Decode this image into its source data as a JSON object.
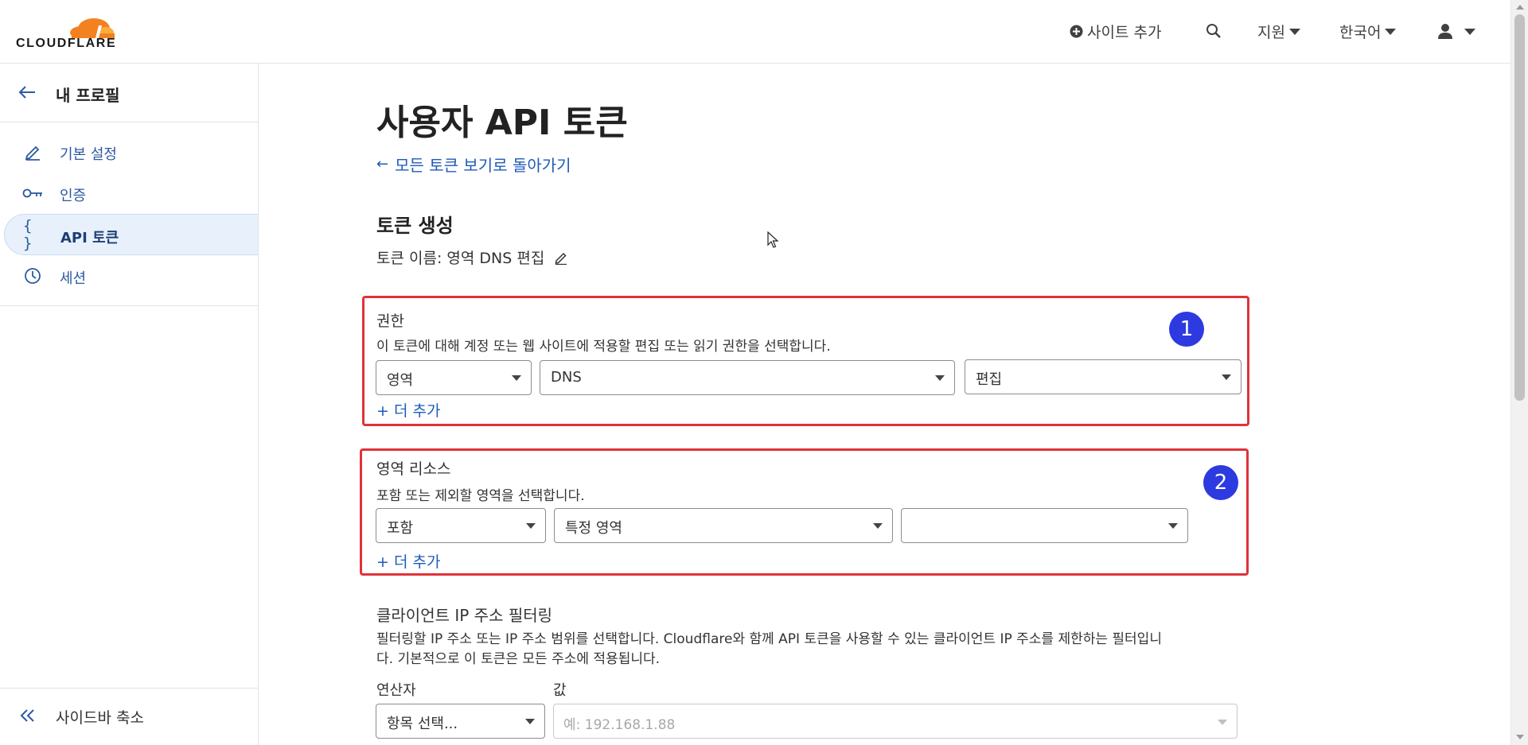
{
  "header": {
    "brand": "CLOUDFLARE",
    "add_site_label": "사이트 추가",
    "support_label": "지원",
    "language_label": "한국어",
    "icons": {
      "add": "plus-circle-icon",
      "search": "search-icon",
      "user": "user-icon"
    },
    "brand_color": "#f48120"
  },
  "sidebar": {
    "back_label": "내 프로필",
    "items": [
      {
        "label": "기본 설정",
        "icon": "pencil-icon",
        "active": false
      },
      {
        "label": "인증",
        "icon": "key-icon",
        "active": false
      },
      {
        "label": "API 토큰",
        "icon": "braces-icon",
        "active": true
      },
      {
        "label": "세션",
        "icon": "clock-icon",
        "active": false
      }
    ],
    "collapse_label": "사이드바 축소"
  },
  "main": {
    "title": "사용자 API 토큰",
    "back_link": "모든 토큰 보기로 돌아가기",
    "section_title": "토큰 생성",
    "token_name": "토큰 이름: 영역 DNS 편집",
    "permissions": {
      "badge": "1",
      "title": "권한",
      "description": "이 토큰에 대해 계정 또는 웹 사이트에 적용할 편집 또는 읽기 권한을 선택합니다.",
      "selects": [
        "영역",
        "DNS",
        "편집"
      ],
      "add_more": "+ 더 추가"
    },
    "zone_resources": {
      "badge": "2",
      "title": "영역 리소스",
      "description": "포함 또는 제외할 영역을 선택합니다.",
      "selects": [
        "포함",
        "특정 영역",
        ""
      ],
      "add_more": "+ 더 추가"
    },
    "ip_filtering": {
      "title": "클라이언트 IP 주소 필터링",
      "description_line1": "필터링할 IP 주소 또는 IP 주소 범위를 선택합니다. Cloudflare와 함께 API 토큰을 사용할 수 있는 클라이언트 IP 주소를 제한하는 필터입니",
      "description_line2": "다. 기본적으로 이 토큰은 모든 주소에 적용됩니다.",
      "operator_label": "연산자",
      "operator_value": "항목 선택...",
      "value_label": "값",
      "value_placeholder": "예: 192.168.1.88"
    },
    "highlight_color": "#e0323b",
    "badge_color": "#2d3ae0",
    "link_color": "#1e5bb8"
  }
}
